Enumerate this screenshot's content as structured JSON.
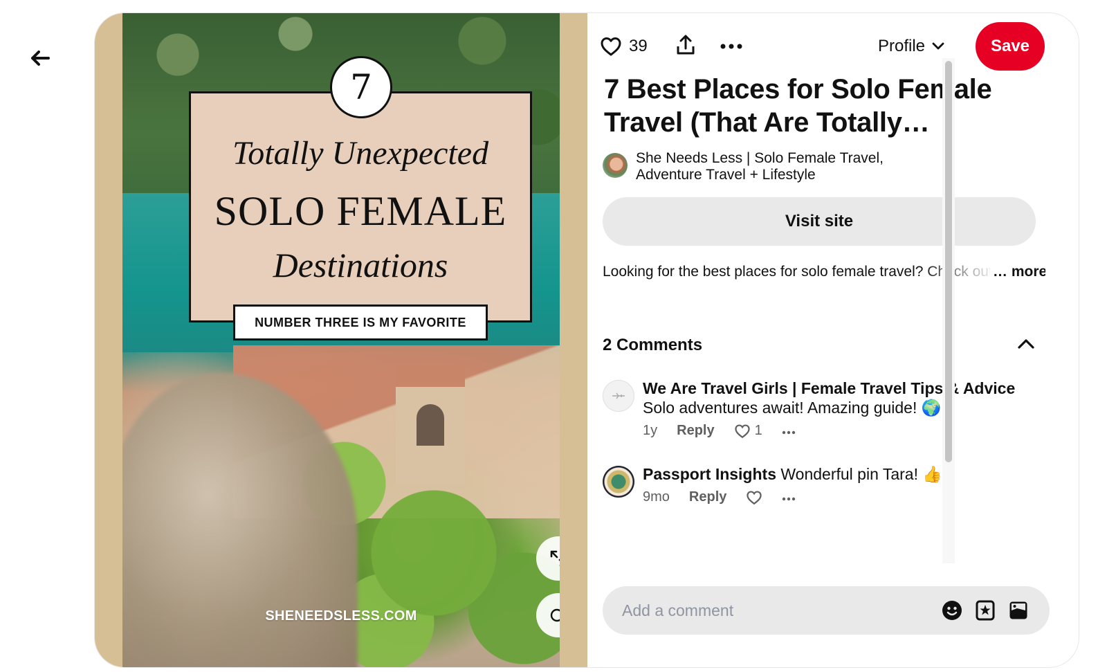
{
  "nav": {
    "back_icon": "arrow-left-icon"
  },
  "pin_image": {
    "number": "7",
    "line1": "Totally Unexpected",
    "line2": "SOLO FEMALE",
    "line3": "Destinations",
    "ribbon": "NUMBER THREE IS MY FAVORITE",
    "watermark": "SHENEEDSLESS.COM",
    "expand_icon": "expand-arrows-icon",
    "visual_search_icon": "visual-search-lens-icon"
  },
  "action_bar": {
    "like_icon": "heart-outline-icon",
    "like_count": "39",
    "share_icon": "share-upload-icon",
    "more_icon": "ellipsis-icon",
    "profile_label": "Profile",
    "save_label": "Save",
    "save_color": "#e60023"
  },
  "pin": {
    "title": "7 Best Places for Solo Female Travel (That Are Totally…",
    "creator": "She Needs Less | Solo Female Travel, Adventure Travel + Lifestyle",
    "visit_label": "Visit site",
    "description": "Looking for the best places for solo female travel? Check out",
    "more_label": "… more"
  },
  "comments": {
    "heading": "2 Comments",
    "items": [
      {
        "author": "We Are Travel Girls | Female Travel Tips & Advice",
        "text": "Solo adventures await! Amazing guide! 🌍",
        "age": "1y",
        "reply_label": "Reply",
        "like_count": "1"
      },
      {
        "author": "Passport Insights",
        "text": "Wonderful pin Tara! 👍",
        "age": "9mo",
        "reply_label": "Reply",
        "like_count": ""
      }
    ]
  },
  "comment_box": {
    "placeholder": "Add a comment",
    "emoji_icon": "emoji-smile-icon",
    "sticker_icon": "sticker-star-icon",
    "image_icon": "image-upload-icon"
  }
}
